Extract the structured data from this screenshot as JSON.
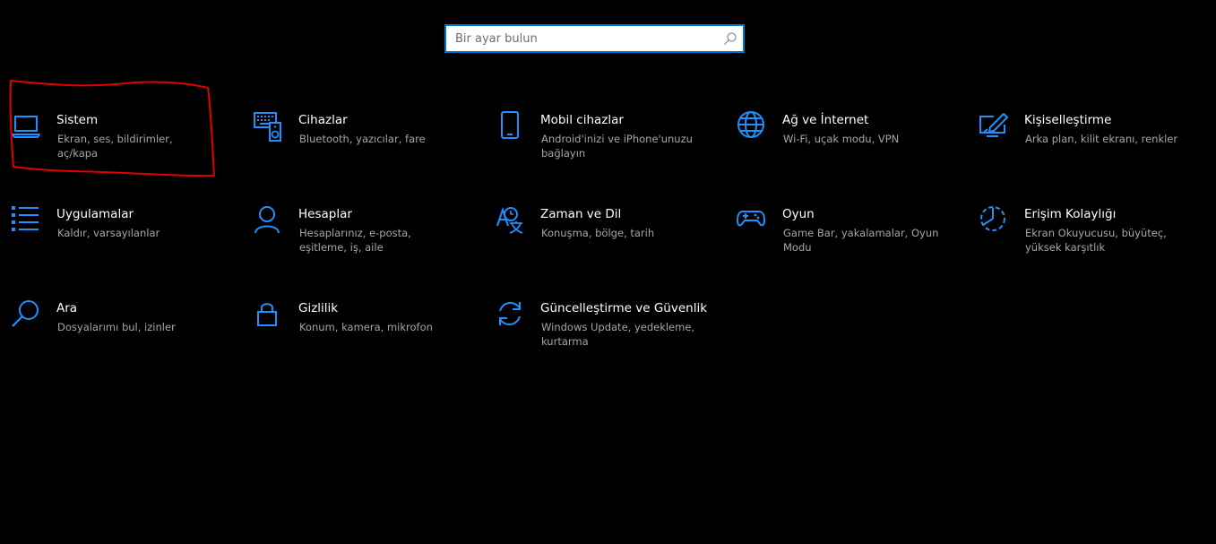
{
  "search": {
    "placeholder": "Bir ayar bulun",
    "value": ""
  },
  "colors": {
    "accent": "#0078d7",
    "icon": "#1e90ff",
    "annotation": "#e00000"
  },
  "tiles": [
    {
      "title": "Sistem",
      "desc": "Ekran, ses, bildirimler, aç/kapa",
      "icon": "laptop-icon"
    },
    {
      "title": "Cihazlar",
      "desc": "Bluetooth, yazıcılar, fare",
      "icon": "keyboard-speaker-icon"
    },
    {
      "title": "Mobil cihazlar",
      "desc": "Android'inizi ve iPhone'unuzu bağlayın",
      "icon": "phone-icon"
    },
    {
      "title": "Ağ ve İnternet",
      "desc": "Wi-Fi, uçak modu, VPN",
      "icon": "globe-icon"
    },
    {
      "title": "Kişiselleştirme",
      "desc": "Arka plan, kilit ekranı, renkler",
      "icon": "brush-screen-icon"
    },
    {
      "title": "Uygulamalar",
      "desc": "Kaldır, varsayılanlar",
      "icon": "app-list-icon"
    },
    {
      "title": "Hesaplar",
      "desc": "Hesaplarınız, e-posta, eşitleme, iş, aile",
      "icon": "person-icon"
    },
    {
      "title": "Zaman ve Dil",
      "desc": "Konuşma, bölge, tarih",
      "icon": "time-language-icon"
    },
    {
      "title": "Oyun",
      "desc": "Game Bar, yakalamalar, Oyun Modu",
      "icon": "gamepad-icon"
    },
    {
      "title": "Erişim Kolaylığı",
      "desc": "Ekran Okuyucusu, büyüteç, yüksek karşıtlık",
      "icon": "ease-of-access-icon"
    },
    {
      "title": "Ara",
      "desc": "Dosyalarımı bul, izinler",
      "icon": "magnifier-icon"
    },
    {
      "title": "Gizlilik",
      "desc": "Konum, kamera, mikrofon",
      "icon": "lock-icon"
    },
    {
      "title": "Güncelleştirme ve Güvenlik",
      "desc": "Windows Update, yedekleme, kurtarma",
      "icon": "sync-arrows-icon"
    }
  ]
}
